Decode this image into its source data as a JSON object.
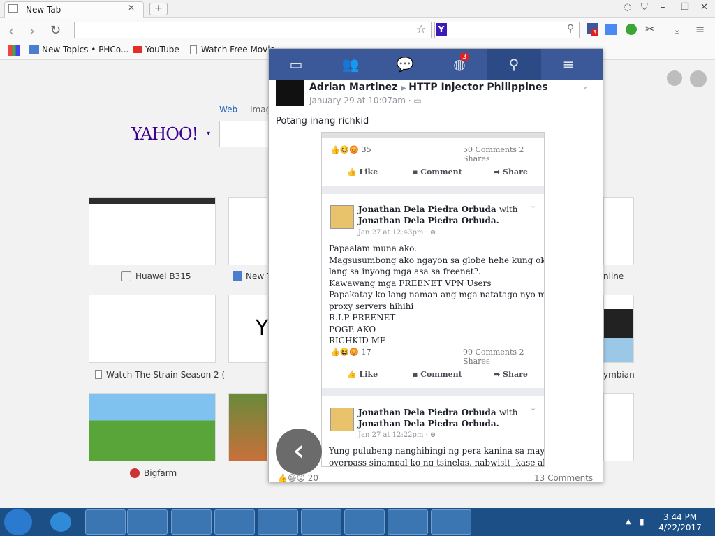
{
  "browser": {
    "tab_title": "New Tab",
    "bookmarks": [
      "New Topics • PHCo...",
      "YouTube",
      "Watch Free Movie"
    ],
    "search_engine_icon": "yahoo-icon"
  },
  "newtab": {
    "yahoo_logo": "YAHOO!",
    "search_tabs": [
      "Web",
      "Imag"
    ],
    "tiles": [
      {
        "label": "Huawei B315"
      },
      {
        "label": "New T"
      },
      {
        "label": "nline"
      },
      {
        "label": "Watch The Strain Season 2 ("
      },
      {
        "label": "ymbian"
      },
      {
        "label": "Bigfarm"
      }
    ]
  },
  "facebook": {
    "notification_count": "3",
    "post": {
      "author": "Adrian Martinez",
      "group": "HTTP Injector Philippines",
      "time": "January 29 at 10:07am",
      "text": "Potang inang richkid",
      "bottom_reactions": "20",
      "bottom_comments": "13 Comments"
    },
    "screenshot": {
      "top_reactions": "35",
      "top_counts": "50 Comments 2 Shares",
      "actions": [
        "Like",
        "Comment",
        "Share"
      ],
      "posts": [
        {
          "name": "Jonathan Dela Piedra Orbuda",
          "with": "with",
          "tagged": "Jonathan Dela Piedra Orbuda.",
          "time": "Jan 27 at 12:43pm",
          "body": "Papaalam muna ako.\nMagsusumbong ako ngayon sa globe hehe kung okay\nlang sa inyong mga asa sa freenet?.\nKawawang mga FREENET VPN Users\nPapakatay ko lang naman ang mga natatago nyo mga\nproxy servers hihihi\nR.I.P FREENET\nPOGE AKO\nRICHKID ME",
          "reactions": "17",
          "counts": "90 Comments 2 Shares"
        },
        {
          "name": "Jonathan Dela Piedra Orbuda",
          "with": "with",
          "tagged": "Jonathan Dela Piedra Orbuda.",
          "time": "Jan 27 at 12:22pm",
          "body": "Yung pulubeng nanghihingi ng pera kanina sa may\noverpass sinampal ko ng tsinelas, nabwisit  kase ako,"
        }
      ]
    }
  },
  "taskbar": {
    "time": "3:44 PM",
    "date": "4/22/2017"
  }
}
